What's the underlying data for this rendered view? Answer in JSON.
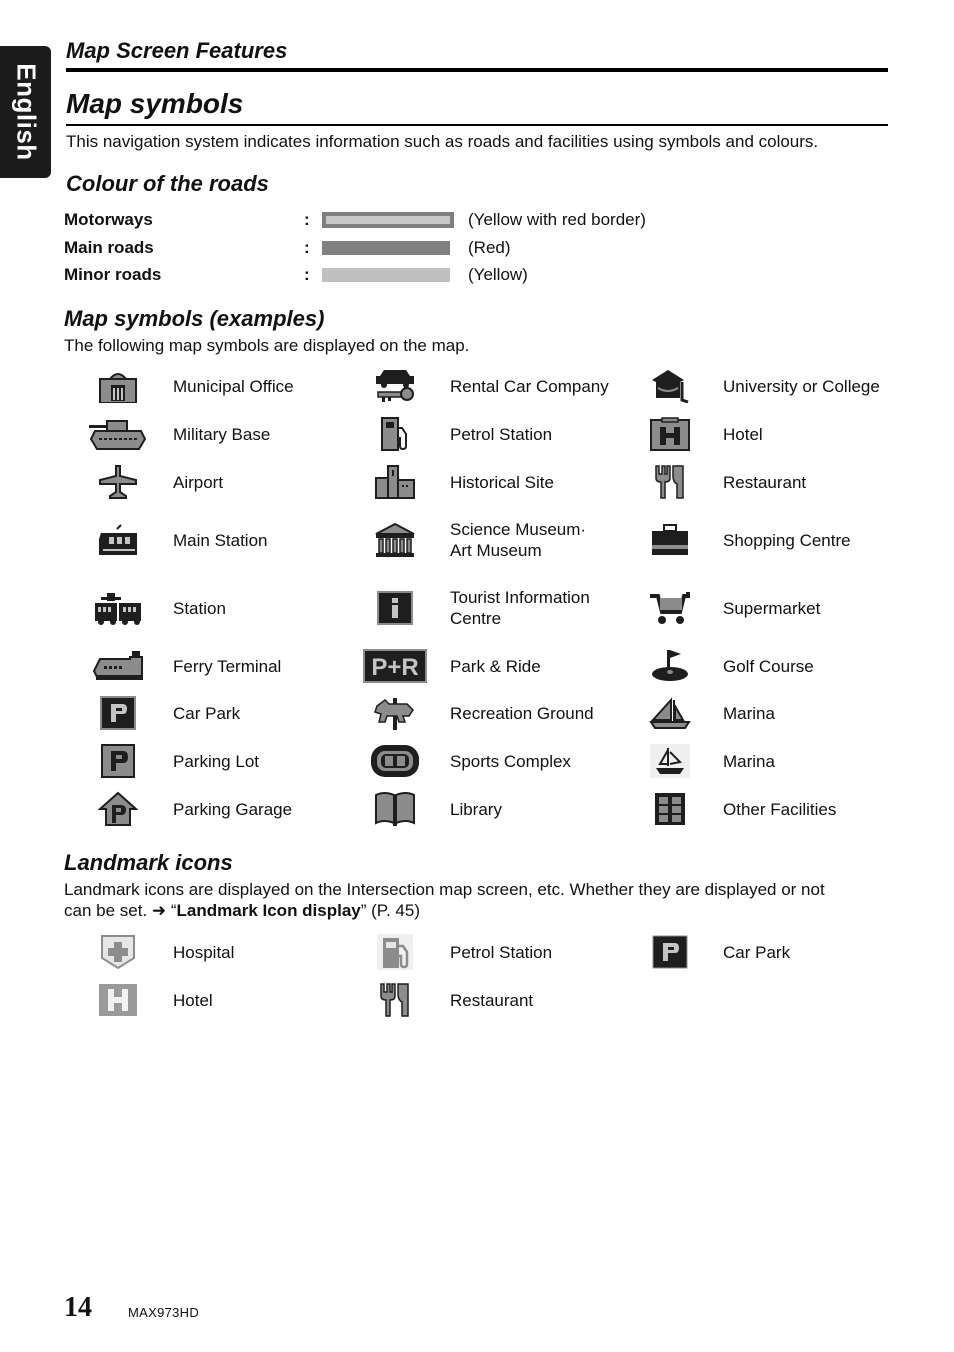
{
  "side_tab": {
    "label": "English"
  },
  "header": {
    "section": "Map Screen Features",
    "title": "Map symbols",
    "intro": "This navigation system indicates information such as roads and facilities using symbols and colours."
  },
  "roads": {
    "heading": "Colour of the roads",
    "items": [
      {
        "name": "Motorways",
        "sep": ":",
        "desc": "(Yellow with red border)",
        "swatch": "motorway"
      },
      {
        "name": "Main roads",
        "sep": ":",
        "desc": "(Red)",
        "swatch": "main"
      },
      {
        "name": "Minor roads",
        "sep": ":",
        "desc": "(Yellow)",
        "swatch": "minor"
      }
    ]
  },
  "symbols": {
    "heading": "Map symbols (examples)",
    "sub": "The following map symbols are displayed on the map.",
    "columns": [
      [
        {
          "icon": "municipal-office-icon",
          "label": "Municipal Office"
        },
        {
          "icon": "military-base-icon",
          "label": "Military Base"
        },
        {
          "icon": "airport-icon",
          "label": "Airport"
        },
        {
          "icon": "main-station-icon",
          "label": "Main Station"
        },
        {
          "icon": "station-icon",
          "label": "Station"
        },
        {
          "icon": "ferry-terminal-icon",
          "label": "Ferry Terminal"
        },
        {
          "icon": "car-park-icon",
          "label": "Car Park"
        },
        {
          "icon": "parking-lot-icon",
          "label": "Parking Lot"
        },
        {
          "icon": "parking-garage-icon",
          "label": "Parking Garage"
        }
      ],
      [
        {
          "icon": "rental-car-icon",
          "label": "Rental Car Company"
        },
        {
          "icon": "petrol-station-icon",
          "label": "Petrol Station"
        },
        {
          "icon": "historical-site-icon",
          "label": "Historical Site"
        },
        {
          "icon": "museum-icon",
          "label": "Science Museum·",
          "label2": "Art Museum"
        },
        {
          "icon": "tourist-info-icon",
          "label": "Tourist Information",
          "label2": "Centre"
        },
        {
          "icon": "park-and-ride-icon",
          "label": "Park & Ride",
          "badge": "P+R"
        },
        {
          "icon": "recreation-ground-icon",
          "label": "Recreation Ground"
        },
        {
          "icon": "sports-complex-icon",
          "label": "Sports Complex"
        },
        {
          "icon": "library-icon",
          "label": "Library"
        }
      ],
      [
        {
          "icon": "university-icon",
          "label": "University or College"
        },
        {
          "icon": "hotel-icon",
          "label": "Hotel"
        },
        {
          "icon": "restaurant-icon",
          "label": "Restaurant"
        },
        {
          "icon": "shopping-centre-icon",
          "label": "Shopping Centre"
        },
        {
          "icon": "supermarket-icon",
          "label": "Supermarket"
        },
        {
          "icon": "golf-course-icon",
          "label": "Golf Course"
        },
        {
          "icon": "marina-icon",
          "label": "Marina"
        },
        {
          "icon": "marina-alt-icon",
          "label": "Marina"
        },
        {
          "icon": "other-facilities-icon",
          "label": "Other Facilities"
        }
      ]
    ]
  },
  "landmarks": {
    "heading": "Landmark icons",
    "text1": "Landmark icons are displayed on the Intersection map screen, etc. Whether they are displayed or not",
    "text2_pre": "can be set. ➜ “",
    "text2_link": "Landmark Icon display",
    "text2_post": "” (P. 45)",
    "items": [
      {
        "icon": "hospital-icon",
        "label": "Hospital"
      },
      {
        "icon": "petrol-station-icon",
        "label": "Petrol Station"
      },
      {
        "icon": "car-park-icon",
        "label": "Car Park"
      },
      {
        "icon": "hotel-icon",
        "label": "Hotel"
      },
      {
        "icon": "restaurant-icon",
        "label": "Restaurant"
      }
    ]
  },
  "footer": {
    "page": "14",
    "model": "MAX973HD"
  }
}
